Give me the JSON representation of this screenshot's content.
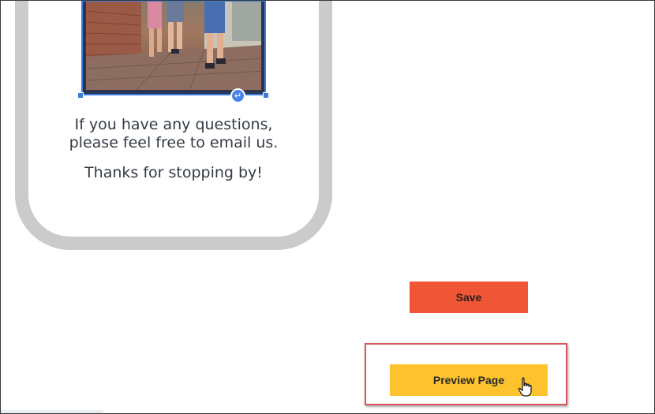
{
  "phone": {
    "questions_text": "If you have any questions,\nplease feel free to email us.",
    "thanks_text": "Thanks for stopping by!",
    "image_wrap_icon": "wrap-text-icon"
  },
  "actions": {
    "save_label": "Save",
    "preview_label": "Preview Page"
  },
  "colors": {
    "selection": "#3b7be0",
    "save": "#f05535",
    "preview": "#fdc22d",
    "highlight": "#d9535a",
    "phone_frame": "#cbcbcb"
  },
  "icons": {
    "cursor": "hand-pointer-icon"
  }
}
